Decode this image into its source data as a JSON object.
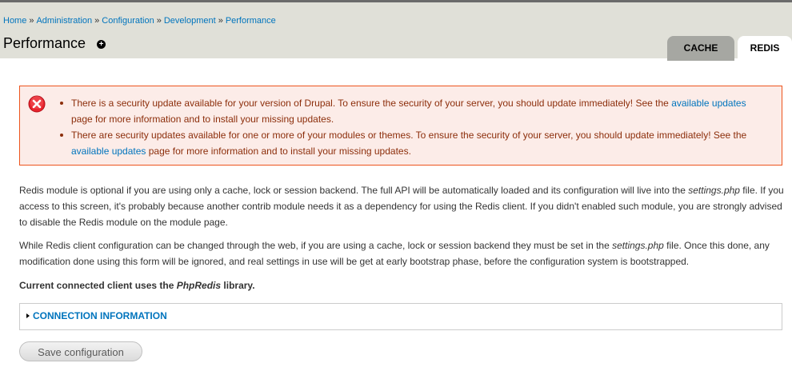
{
  "breadcrumb": {
    "items": [
      "Home",
      "Administration",
      "Configuration",
      "Development",
      "Performance"
    ],
    "separator": "»"
  },
  "page": {
    "title": "Performance",
    "shortcut_symbol": "+"
  },
  "tabs": [
    {
      "label": "CACHE",
      "active": false
    },
    {
      "label": "REDIS",
      "active": true
    }
  ],
  "messages": {
    "items": [
      {
        "before": "There is a security update available for your version of Drupal. To ensure the security of your server, you should update immediately! See the ",
        "link": "available updates",
        "after": " page for more information and to install your missing updates."
      },
      {
        "before": "There are security updates available for one or more of your modules or themes. To ensure the security of your server, you should update immediately! See the ",
        "link": "available updates",
        "after": " page for more information and to install your missing updates."
      }
    ]
  },
  "content": {
    "p1": {
      "a": "Redis module is optional if you are using only a cache, lock or session backend. The full API will be automatically loaded and its configuration will live into the ",
      "em": "settings.php",
      "b": " file. If you access to this screen, it's probably because another contrib module needs it as a dependency for using the Redis client. If you didn't enabled such module, you are strongly advised to disable the Redis module on the module page."
    },
    "p2": {
      "a": "While Redis client configuration can be changed through the web, if you are using a cache, lock or session backend they must be set in the ",
      "em": "settings.php",
      "b": " file. Once this done, any modification done using this form will be ignored, and real settings in use will be get at early bootstrap phase, before the configuration system is bootstrapped."
    },
    "p3": {
      "a": "Current connected client uses the ",
      "em": "PhpRedis",
      "b": " library."
    }
  },
  "fieldset": {
    "legend": "CONNECTION INFORMATION"
  },
  "actions": {
    "save_label": "Save configuration"
  }
}
